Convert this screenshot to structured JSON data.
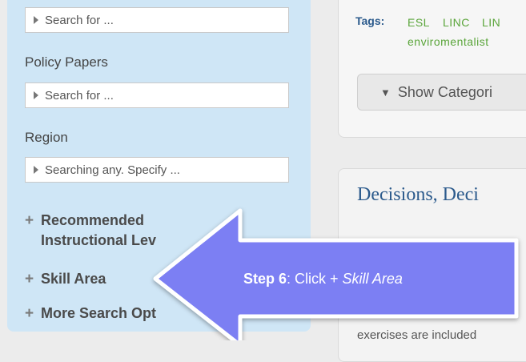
{
  "sidebar": {
    "first_field_placeholder": "Search for ...",
    "policy_papers_label": "Policy Papers",
    "policy_papers_placeholder": "Search for ...",
    "region_label": "Region",
    "region_placeholder": "Searching any. Specify ...",
    "expanders": [
      {
        "line1": "Recommended",
        "line2": "Instructional Lev"
      },
      {
        "line1": "Skill Area"
      },
      {
        "line1": "More Search Opt"
      }
    ],
    "plus_symbol": "+"
  },
  "resource": {
    "tags_label": "Tags:",
    "tags": [
      "ESL",
      "LINC",
      "LIN",
      "enviromentalist"
    ],
    "show_categories_label": "Show Categori",
    "title": "Decisions, Deci",
    "body_fragment": "exercises are included"
  },
  "callout": {
    "step": "Step 6",
    "text_prefix": ": Click + ",
    "target": "Skill Area",
    "fill_color": "#7b7ff3",
    "border_color": "#ffffff"
  }
}
